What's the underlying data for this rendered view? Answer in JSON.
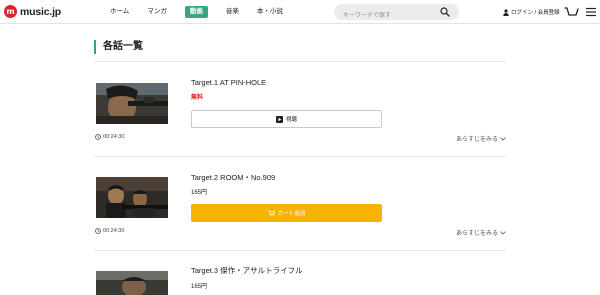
{
  "header": {
    "logo_text": "music.jp",
    "logo_mark": "m",
    "nav": [
      {
        "label": "ホーム",
        "active": false
      },
      {
        "label": "マンガ",
        "active": false
      },
      {
        "label": "動画",
        "active": true
      },
      {
        "label": "音楽",
        "active": false
      },
      {
        "label": "本・小説",
        "active": false
      }
    ],
    "search_placeholder": "キーワードで探す",
    "login_label": "ログイン / 会員登録"
  },
  "main": {
    "title": "各話一覧",
    "episodes": [
      {
        "title": "Target.1 AT PIN-HOLE",
        "price": "無料",
        "button": "視聴",
        "button_type": "play",
        "duration": "00:24:30",
        "synopsis": "あらすじをみる"
      },
      {
        "title": "Target.2 ROOM・No.909",
        "price": "165円",
        "button": "カート追加",
        "button_type": "cart",
        "duration": "00:24:30",
        "synopsis": "あらすじをみる"
      },
      {
        "title": "Target.3 傑作・アサルトライフル",
        "price": "165円",
        "button": "",
        "button_type": "",
        "duration": "",
        "synopsis": ""
      }
    ]
  },
  "colors": {
    "accent": "#3aa67c",
    "brand": "#d9262a",
    "cart": "#f5b400"
  }
}
